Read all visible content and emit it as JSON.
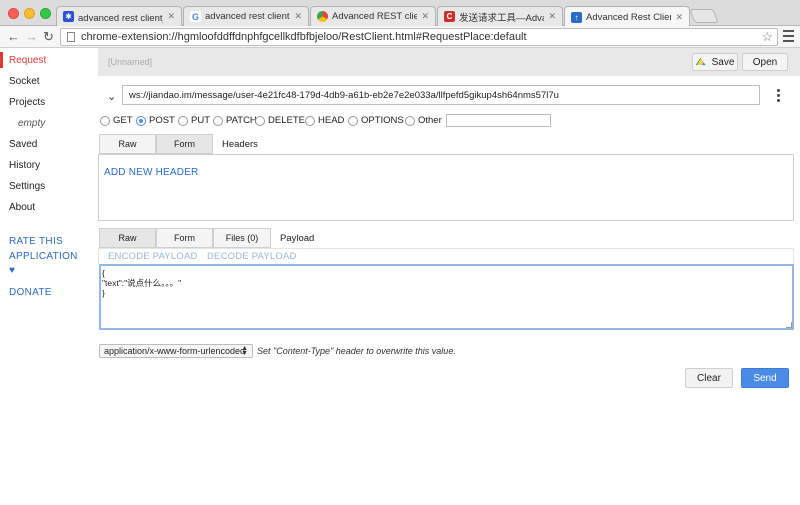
{
  "browser": {
    "tabs": [
      {
        "label": "advanced rest client_百度搜",
        "icon": "baidu-paw-icon",
        "color": "#2e4fd6"
      },
      {
        "label": "advanced rest client - Goo",
        "icon": "google-g-icon",
        "color": "#4285f4"
      },
      {
        "label": "Advanced REST client - Ch",
        "icon": "chrome-webstore-icon",
        "color": "#e94235"
      },
      {
        "label": "发送请求工具—Advanced R",
        "icon": "csdn-c-icon",
        "color": "#c9302c"
      },
      {
        "label": "Advanced Rest Client Appl",
        "icon": "arc-app-icon",
        "color": "#2a6cc5"
      }
    ],
    "tab_close": "✕",
    "url": "chrome-extension://hgmloofddffdnphfgcellkdfbfbjeloo/RestClient.html#RequestPlace:default"
  },
  "sidebar": {
    "items": [
      "Request",
      "Socket",
      "Projects"
    ],
    "projects_empty": "empty",
    "items2": [
      "Saved",
      "History",
      "Settings",
      "About"
    ],
    "rate_line1": "RATE THIS",
    "rate_line2": "APPLICATION",
    "heart": "♥",
    "donate": "DONATE"
  },
  "request": {
    "name_placeholder": "[Unnamed]",
    "save_label": "Save",
    "open_label": "Open",
    "url": "ws://jiandao.im/message/user-4e21fc48-179d-4db9-a61b-eb2e7e2e033a/llfpefd5gikup4sh64nms57l7u",
    "methods": [
      "GET",
      "POST",
      "PUT",
      "PATCH",
      "DELETE",
      "HEAD",
      "OPTIONS",
      "Other"
    ],
    "selected_method": "POST",
    "headers_tabs": [
      "Raw",
      "Form"
    ],
    "headers_title": "Headers",
    "add_header": "ADD NEW HEADER",
    "payload_tabs": [
      "Raw",
      "Form",
      "Files (0)"
    ],
    "payload_title": "Payload",
    "encode_payload": "ENCODE PAYLOAD",
    "decode_payload": "DECODE PAYLOAD",
    "payload_body": "{\n\"text\":\"说点什么。。。\"\n}",
    "content_type": "application/x-www-form-urlencoded",
    "content_type_hint": "Set \"Content-Type\" header to overwrite this value.",
    "clear_label": "Clear",
    "send_label": "Send"
  }
}
